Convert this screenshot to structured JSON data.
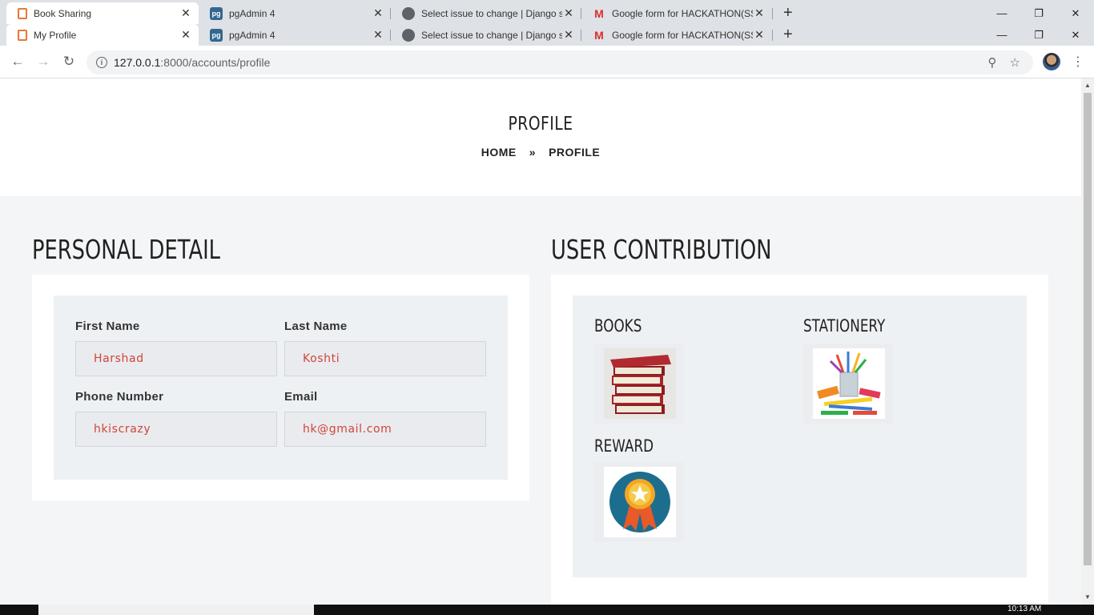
{
  "browser": {
    "tabs_row1": [
      {
        "title": "Book Sharing",
        "icon": "book-icon"
      },
      {
        "title": "pgAdmin 4",
        "icon": "pgadmin-icon"
      },
      {
        "title": "Select issue to change | Django s",
        "icon": "globe-icon"
      },
      {
        "title": "Google form for HACKATHON(SS",
        "icon": "gmail-icon"
      }
    ],
    "tabs_row2": [
      {
        "title": "My Profile",
        "icon": "book-icon"
      },
      {
        "title": "pgAdmin 4",
        "icon": "pgadmin-icon"
      },
      {
        "title": "Select issue to change | Django s",
        "icon": "globe-icon"
      },
      {
        "title": "Google form for HACKATHON(SS",
        "icon": "gmail-icon"
      }
    ],
    "url_host": "127.0.0.1",
    "url_rest": ":8000/accounts/profile"
  },
  "hero": {
    "title": "PROFILE",
    "breadcrumb_home": "HOME",
    "breadcrumb_sep": "»",
    "breadcrumb_current": "PROFILE"
  },
  "personal": {
    "heading": "PERSONAL DETAIL",
    "first_name_label": "First Name",
    "first_name_value": "Harshad",
    "last_name_label": "Last Name",
    "last_name_value": "Koshti",
    "phone_label": "Phone Number",
    "phone_value": "hkiscrazy",
    "email_label": "Email",
    "email_value": "hk@gmail.com"
  },
  "contribution": {
    "heading": "USER CONTRIBUTION",
    "books": "BOOKS",
    "stationery": "STATIONERY",
    "reward": "REWARD"
  },
  "taskbar": {
    "time": "10:13 AM"
  },
  "colors": {
    "field_text": "#d0453a",
    "page_bg": "#f4f5f7",
    "inner_bg": "#eef1f4"
  }
}
